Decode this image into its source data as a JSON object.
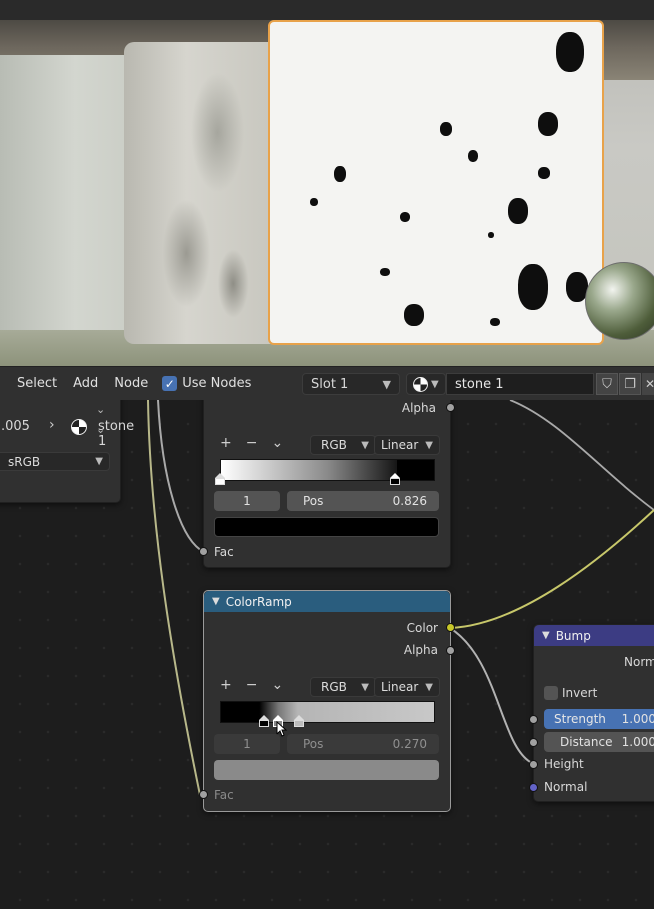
{
  "header": {
    "menu": [
      "Select",
      "Add",
      "Node"
    ],
    "use_nodes_label": "Use Nodes",
    "use_nodes_checked": "✓",
    "slot_label": "Slot 1",
    "material_name": "stone 1"
  },
  "image_node": {
    "value_partial": ".005",
    "material_name": "stone 1",
    "color_space": "sRGB",
    "chevron": "⌄"
  },
  "colorramp_top": {
    "output_alpha": "Alpha",
    "color_mode": "RGB",
    "interpolation": "Linear",
    "stop_index": "1",
    "pos_label": "Pos",
    "pos_value": "0.826",
    "input_fac": "Fac",
    "swatch_color": "#000000"
  },
  "colorramp_bottom": {
    "title": "ColorRamp",
    "output_color": "Color",
    "output_alpha": "Alpha",
    "color_mode": "RGB",
    "interpolation": "Linear",
    "stop_index": "1",
    "pos_label": "Pos",
    "pos_value": "0.270",
    "input_fac": "Fac",
    "swatch_color": "#8a8a8a"
  },
  "bump_node": {
    "title": "Bump",
    "output_normal_partial": "Norm",
    "invert_label": "Invert",
    "strength_label": "Strength",
    "strength_value": "1.000",
    "distance_label": "Distance",
    "distance_value": "1.000",
    "input_height": "Height",
    "input_normal": "Normal"
  },
  "ramp_tools": {
    "add": "+",
    "remove": "−",
    "menu": "⌄"
  },
  "colors": {
    "colorramp_header": "#2a5d7e",
    "bump_header": "#3c3c83",
    "selection_outline": "#e8a24a",
    "checkbox_accent": "#4772b3",
    "strength_slider": "#4772b3"
  }
}
